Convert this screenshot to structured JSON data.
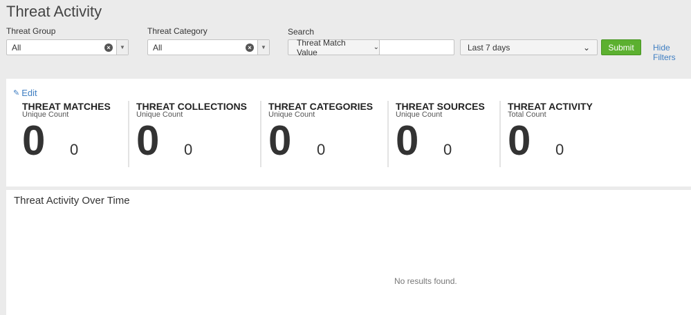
{
  "page": {
    "title": "Threat Activity"
  },
  "filters": {
    "threat_group": {
      "label": "Threat Group",
      "value": "All"
    },
    "threat_category": {
      "label": "Threat Category",
      "value": "All"
    },
    "search": {
      "label": "Search",
      "field_dropdown": "Threat Match Value",
      "input_value": ""
    },
    "time_range": "Last 7 days",
    "submit_label": "Submit",
    "hide_filters_label": "Hide Filters"
  },
  "dashboard": {
    "edit_label": "Edit",
    "stats": [
      {
        "title": "THREAT MATCHES",
        "subtitle": "Unique Count",
        "value": "0",
        "delta": "0"
      },
      {
        "title": "THREAT COLLECTIONS",
        "subtitle": "Unique Count",
        "value": "0",
        "delta": "0"
      },
      {
        "title": "THREAT CATEGORIES",
        "subtitle": "Unique Count",
        "value": "0",
        "delta": "0"
      },
      {
        "title": "THREAT SOURCES",
        "subtitle": "Unique Count",
        "value": "0",
        "delta": "0"
      },
      {
        "title": "THREAT ACTIVITY",
        "subtitle": "Total Count",
        "value": "0",
        "delta": "0"
      }
    ]
  },
  "chart_panel": {
    "title": "Threat Activity Over Time",
    "empty_message": "No results found."
  }
}
